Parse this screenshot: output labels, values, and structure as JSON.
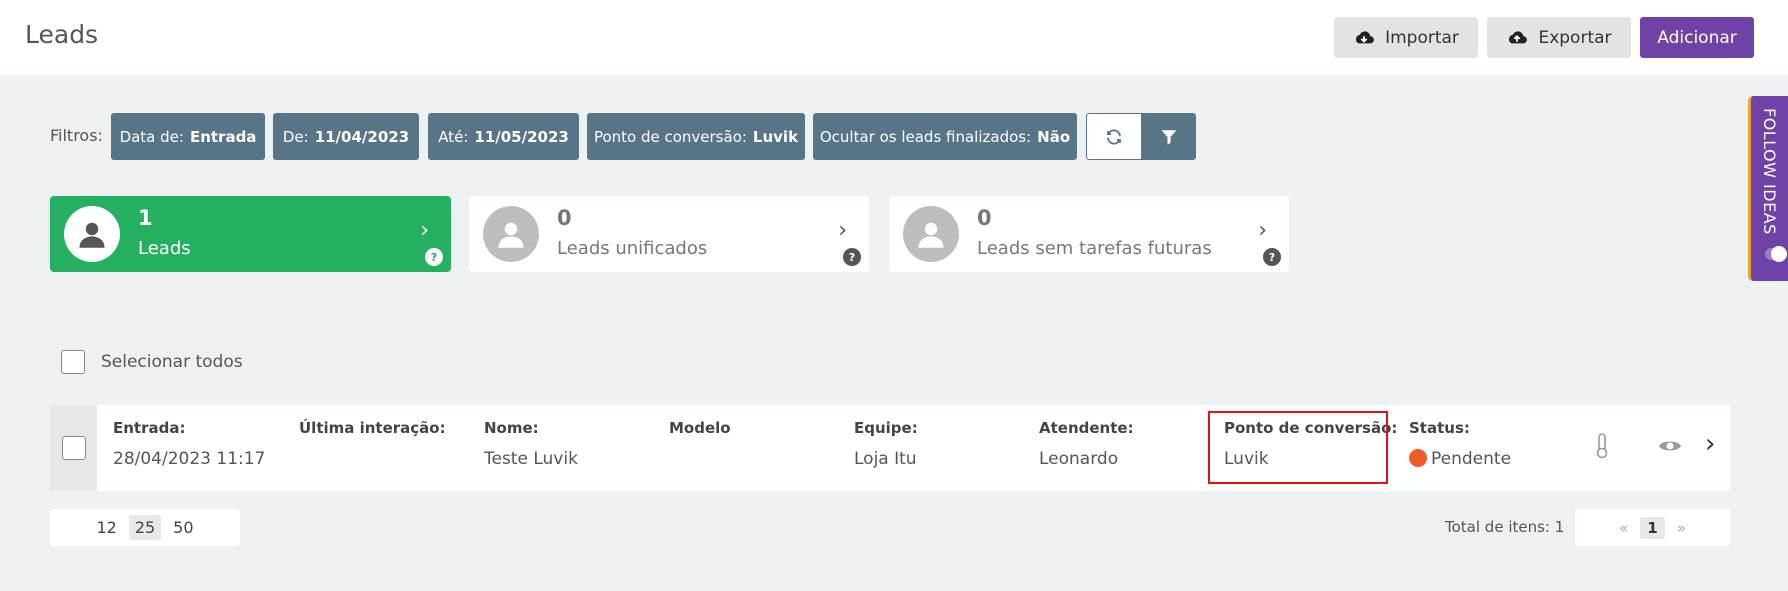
{
  "header": {
    "title": "Leads",
    "import_label": "Importar",
    "export_label": "Exportar",
    "add_label": "Adicionar"
  },
  "filters": {
    "label": "Filtros:",
    "chips": [
      {
        "key": "Data de:",
        "value": "Entrada"
      },
      {
        "key": "De:",
        "value": "11/04/2023"
      },
      {
        "key": "Até:",
        "value": "11/05/2023"
      },
      {
        "key": "Ponto de conversão:",
        "value": "Luvik"
      },
      {
        "key": "Ocultar os leads finalizados:",
        "value": "Não"
      }
    ]
  },
  "cards": [
    {
      "count": "1",
      "label": "Leads"
    },
    {
      "count": "0",
      "label": "Leads unificados"
    },
    {
      "count": "0",
      "label": "Leads sem tarefas futuras"
    }
  ],
  "list": {
    "select_all_label": "Selecionar todos",
    "row": {
      "entrada": {
        "label": "Entrada:",
        "value": "28/04/2023 11:17"
      },
      "ultima": {
        "label": "Última interação:",
        "value": ""
      },
      "nome": {
        "label": "Nome:",
        "value": "Teste Luvik"
      },
      "modelo": {
        "label": "Modelo",
        "value": ""
      },
      "equipe": {
        "label": "Equipe:",
        "value": "Loja Itu"
      },
      "atendente": {
        "label": "Atendente:",
        "value": "Leonardo"
      },
      "ponto": {
        "label": "Ponto de conversão:",
        "value": "Luvik"
      },
      "status": {
        "label": "Status:",
        "value": "Pendente"
      }
    }
  },
  "pagination": {
    "sizes": [
      "12",
      "25",
      "50"
    ],
    "selected_size": "25",
    "total_label": "Total de itens: 1",
    "prev": "«",
    "current": "1",
    "next": "»"
  },
  "side_tab": {
    "label": "FOLLOW IDEAS"
  },
  "colors": {
    "accent": "#6f42a6",
    "chip": "#587487",
    "active_card": "#25af60",
    "status_pending": "#ef5b2b",
    "highlight": "#e0131a"
  }
}
